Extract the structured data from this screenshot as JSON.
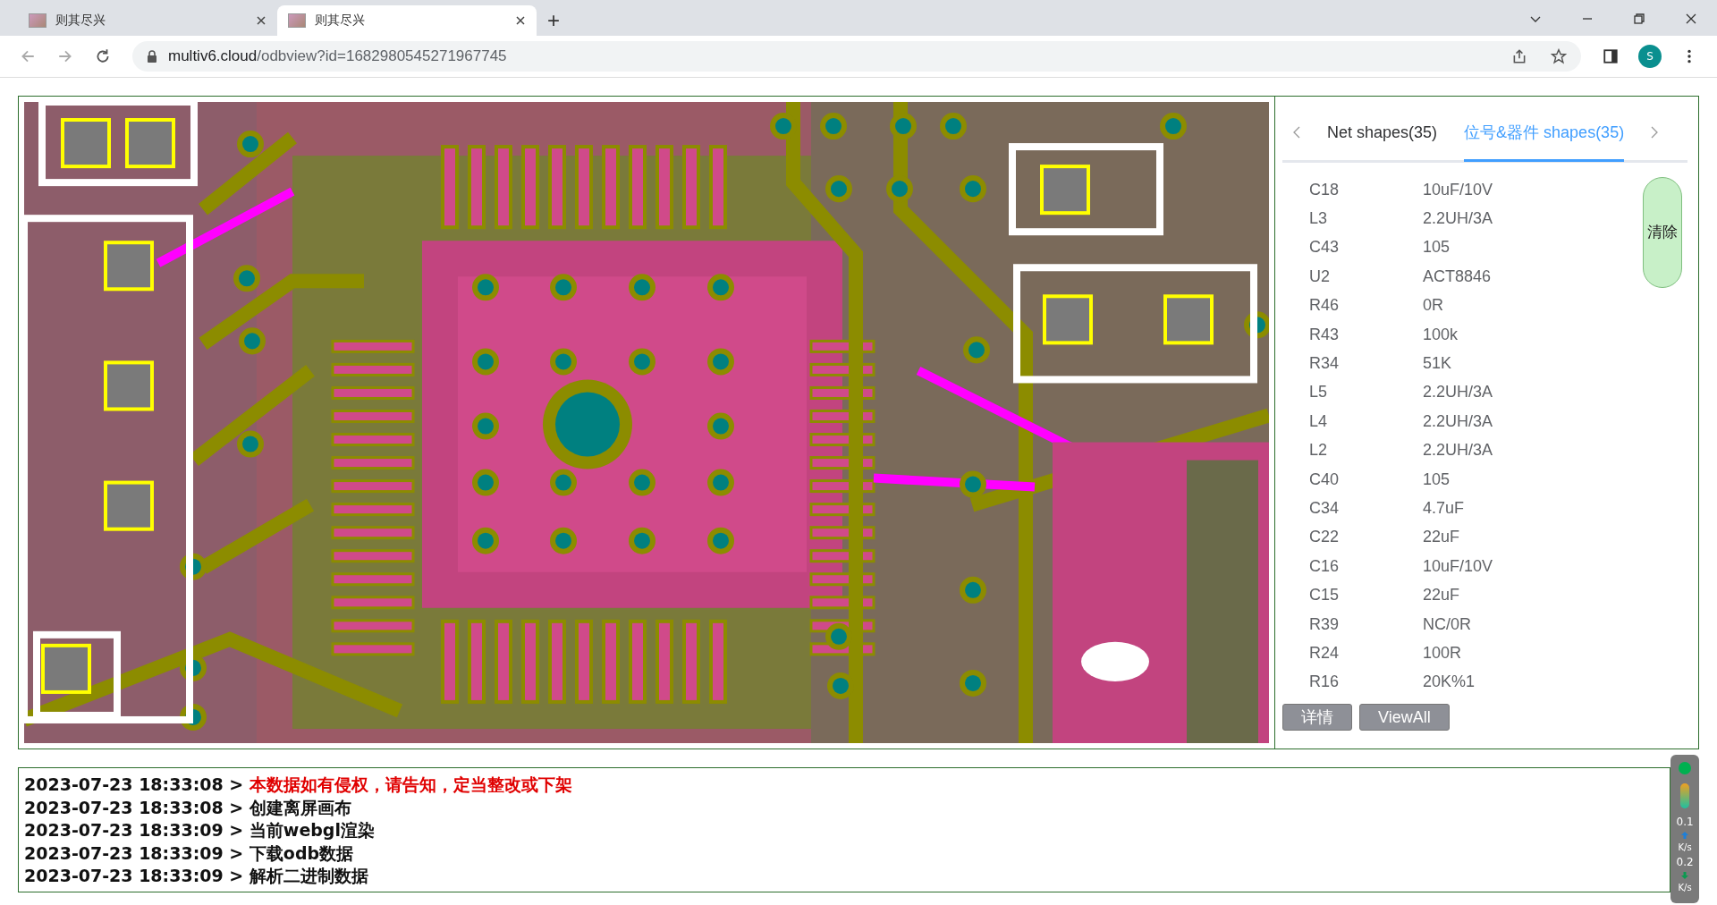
{
  "browser": {
    "tabs": [
      {
        "title": "则其尽兴",
        "selected": false
      },
      {
        "title": "则其尽兴",
        "selected": true
      }
    ],
    "new_tab": "+",
    "url_host": "multiv6.cloud",
    "url_path": "/odbview?id=1682980545271967745",
    "profile_initial": "S"
  },
  "panel": {
    "tabs": [
      {
        "label": "Net shapes(35)",
        "selected": false
      },
      {
        "label": "位号&器件 shapes(35)",
        "selected": true
      }
    ],
    "clear_button": "清除",
    "rows": [
      {
        "ref": "C18",
        "value": "10uF/10V"
      },
      {
        "ref": "L3",
        "value": "2.2UH/3A"
      },
      {
        "ref": "C43",
        "value": "105"
      },
      {
        "ref": "U2",
        "value": "ACT8846"
      },
      {
        "ref": "R46",
        "value": "0R"
      },
      {
        "ref": "R43",
        "value": "100k"
      },
      {
        "ref": "R34",
        "value": "51K"
      },
      {
        "ref": "L5",
        "value": "2.2UH/3A"
      },
      {
        "ref": "L4",
        "value": "2.2UH/3A"
      },
      {
        "ref": "L2",
        "value": "2.2UH/3A"
      },
      {
        "ref": "C40",
        "value": "105"
      },
      {
        "ref": "C34",
        "value": "4.7uF"
      },
      {
        "ref": "C22",
        "value": "22uF"
      },
      {
        "ref": "C16",
        "value": "10uF/10V"
      },
      {
        "ref": "C15",
        "value": "22uF"
      },
      {
        "ref": "R39",
        "value": "NC/0R"
      },
      {
        "ref": "R24",
        "value": "100R"
      },
      {
        "ref": "R16",
        "value": "20K%1"
      }
    ],
    "buttons": [
      "详情",
      "ViewAll"
    ]
  },
  "log": [
    {
      "time": "2023-07-23 18:33:08",
      "separator": ">",
      "message": "本数据如有侵权，请告知，定当整改或下架",
      "kind": "warning"
    },
    {
      "time": "2023-07-23 18:33:08",
      "separator": ">",
      "message": "创建离屏画布",
      "kind": "info"
    },
    {
      "time": "2023-07-23 18:33:09",
      "separator": ">",
      "message": "当前webgl渲染",
      "kind": "info"
    },
    {
      "time": "2023-07-23 18:33:09",
      "separator": ">",
      "message": "下载odb数据",
      "kind": "info"
    },
    {
      "time": "2023-07-23 18:33:09",
      "separator": ">",
      "message": "解析二进制数据",
      "kind": "info"
    }
  ],
  "speed_monitor": {
    "upload": "0.1",
    "upload_unit": "K/s",
    "download": "0.2",
    "download_unit": "K/s"
  }
}
